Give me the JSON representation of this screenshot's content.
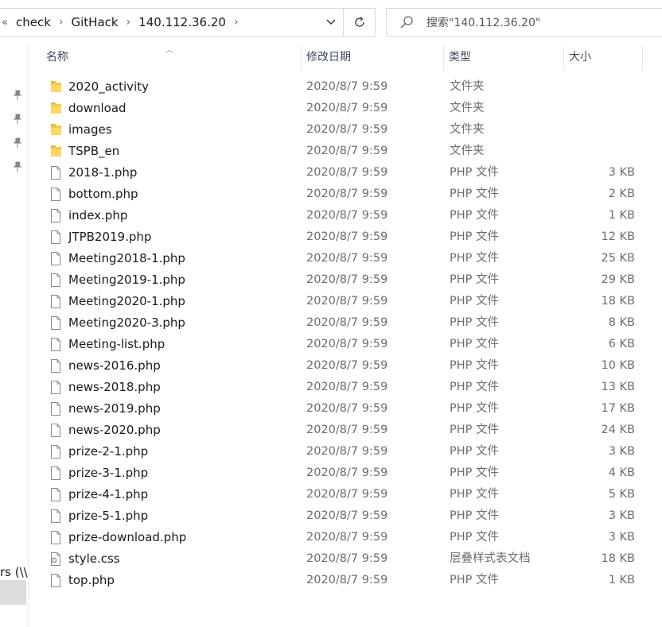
{
  "breadcrumb": {
    "overflow": "«",
    "items": [
      "check",
      "GitHack",
      "140.112.36.20"
    ]
  },
  "search": {
    "placeholder": "搜索\"140.112.36.20\""
  },
  "nav": {
    "partial_label": "rs (\\\\"
  },
  "columns": {
    "name": "名称",
    "date": "修改日期",
    "type": "类型",
    "size": "大小"
  },
  "files": [
    {
      "name": "2020_activity",
      "date": "2020/8/7 9:59",
      "type": "文件夹",
      "size": "",
      "icon": "folder-icon"
    },
    {
      "name": "download",
      "date": "2020/8/7 9:59",
      "type": "文件夹",
      "size": "",
      "icon": "folder-icon"
    },
    {
      "name": "images",
      "date": "2020/8/7 9:59",
      "type": "文件夹",
      "size": "",
      "icon": "folder-icon"
    },
    {
      "name": "TSPB_en",
      "date": "2020/8/7 9:59",
      "type": "文件夹",
      "size": "",
      "icon": "folder-icon"
    },
    {
      "name": "2018-1.php",
      "date": "2020/8/7 9:59",
      "type": "PHP 文件",
      "size": "3 KB",
      "icon": "file-icon"
    },
    {
      "name": "bottom.php",
      "date": "2020/8/7 9:59",
      "type": "PHP 文件",
      "size": "2 KB",
      "icon": "file-icon"
    },
    {
      "name": "index.php",
      "date": "2020/8/7 9:59",
      "type": "PHP 文件",
      "size": "1 KB",
      "icon": "file-icon"
    },
    {
      "name": "JTPB2019.php",
      "date": "2020/8/7 9:59",
      "type": "PHP 文件",
      "size": "12 KB",
      "icon": "file-icon"
    },
    {
      "name": "Meeting2018-1.php",
      "date": "2020/8/7 9:59",
      "type": "PHP 文件",
      "size": "25 KB",
      "icon": "file-icon"
    },
    {
      "name": "Meeting2019-1.php",
      "date": "2020/8/7 9:59",
      "type": "PHP 文件",
      "size": "29 KB",
      "icon": "file-icon"
    },
    {
      "name": "Meeting2020-1.php",
      "date": "2020/8/7 9:59",
      "type": "PHP 文件",
      "size": "18 KB",
      "icon": "file-icon"
    },
    {
      "name": "Meeting2020-3.php",
      "date": "2020/8/7 9:59",
      "type": "PHP 文件",
      "size": "8 KB",
      "icon": "file-icon"
    },
    {
      "name": "Meeting-list.php",
      "date": "2020/8/7 9:59",
      "type": "PHP 文件",
      "size": "6 KB",
      "icon": "file-icon"
    },
    {
      "name": "news-2016.php",
      "date": "2020/8/7 9:59",
      "type": "PHP 文件",
      "size": "10 KB",
      "icon": "file-icon"
    },
    {
      "name": "news-2018.php",
      "date": "2020/8/7 9:59",
      "type": "PHP 文件",
      "size": "13 KB",
      "icon": "file-icon"
    },
    {
      "name": "news-2019.php",
      "date": "2020/8/7 9:59",
      "type": "PHP 文件",
      "size": "17 KB",
      "icon": "file-icon"
    },
    {
      "name": "news-2020.php",
      "date": "2020/8/7 9:59",
      "type": "PHP 文件",
      "size": "24 KB",
      "icon": "file-icon"
    },
    {
      "name": "prize-2-1.php",
      "date": "2020/8/7 9:59",
      "type": "PHP 文件",
      "size": "3 KB",
      "icon": "file-icon"
    },
    {
      "name": "prize-3-1.php",
      "date": "2020/8/7 9:59",
      "type": "PHP 文件",
      "size": "4 KB",
      "icon": "file-icon"
    },
    {
      "name": "prize-4-1.php",
      "date": "2020/8/7 9:59",
      "type": "PHP 文件",
      "size": "5 KB",
      "icon": "file-icon"
    },
    {
      "name": "prize-5-1.php",
      "date": "2020/8/7 9:59",
      "type": "PHP 文件",
      "size": "3 KB",
      "icon": "file-icon"
    },
    {
      "name": "prize-download.php",
      "date": "2020/8/7 9:59",
      "type": "PHP 文件",
      "size": "3 KB",
      "icon": "file-icon"
    },
    {
      "name": "style.css",
      "date": "2020/8/7 9:59",
      "type": "层叠样式表文档",
      "size": "18 KB",
      "icon": "css-file-icon"
    },
    {
      "name": "top.php",
      "date": "2020/8/7 9:59",
      "type": "PHP 文件",
      "size": "1 KB",
      "icon": "file-icon"
    }
  ]
}
